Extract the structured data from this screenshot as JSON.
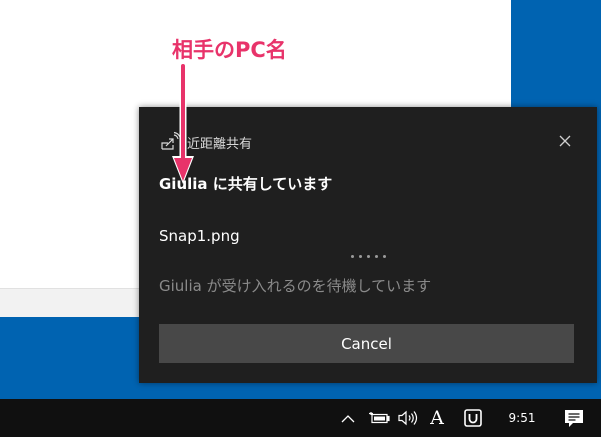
{
  "annotation": {
    "label": "相手のPC名",
    "color": "#e8336a"
  },
  "toast": {
    "app_name": "近距離共有",
    "app_icon": "nearby-share-icon",
    "close_icon": "close-icon",
    "title": "Giulia に共有しています",
    "file_name": "Snap1.png",
    "status": "Giulia が受け入れるのを待機しています",
    "cancel_label": "Cancel",
    "progress_dot_count": 5,
    "background": "#1f1f1f",
    "button_color": "#484848"
  },
  "taskbar": {
    "tray_icons": [
      "chevron-up-icon",
      "battery-icon",
      "volume-icon",
      "ime-mode-icon",
      "ime-status-icon"
    ],
    "ime_mode": "A",
    "time": "9:51",
    "notification_icon": "action-center-icon",
    "background": "#101010"
  },
  "desktop_color": "#0063b1"
}
